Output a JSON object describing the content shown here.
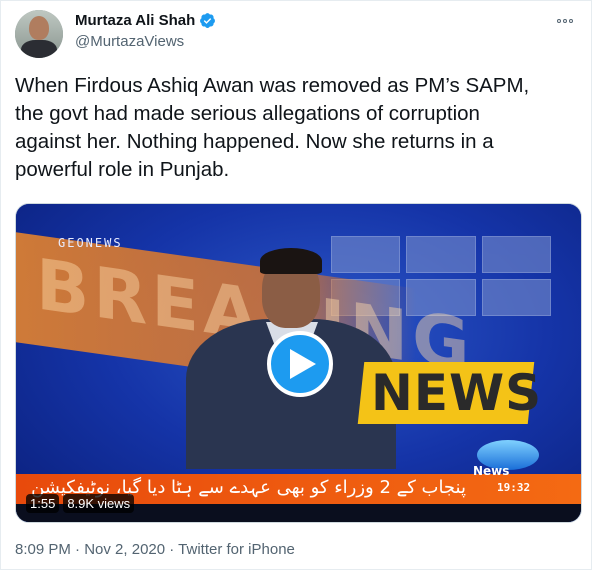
{
  "author": {
    "name": "Murtaza Ali Shah",
    "handle": "@MurtazaViews",
    "verified": true,
    "verified_color": "#1d9bf0"
  },
  "tweet": {
    "text_lines": [
      "When Firdous Ashiq Awan was removed as PM’s SAPM,",
      "the govt had made serious allegations of corruption",
      "against her. Nothing happened. Now she returns in a",
      "powerful role in Punjab."
    ]
  },
  "video": {
    "channel_label": "GEONEWS",
    "breaking_text": "BREAKING",
    "news_box_text": "NEWS",
    "ticker_text": "پنجاب کے 2 وزراء کو بھی عہدے سے ہٹا دیا گیا، نوٹیفکیشن",
    "logo_word": "News",
    "logo_time": "19:32",
    "duration": "1:55",
    "views": "8.9K views",
    "play_icon": "play-icon",
    "play_color": "#1d9bf0"
  },
  "meta": {
    "time": "8:09 PM",
    "date": "Nov 2, 2020",
    "source": "Twitter for iPhone",
    "separator": " · "
  }
}
